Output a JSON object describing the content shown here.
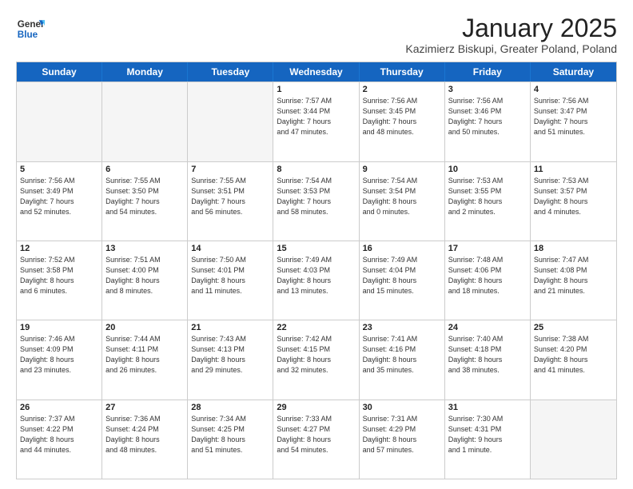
{
  "logo": {
    "general": "General",
    "blue": "Blue"
  },
  "title": "January 2025",
  "subtitle": "Kazimierz Biskupi, Greater Poland, Poland",
  "headers": [
    "Sunday",
    "Monday",
    "Tuesday",
    "Wednesday",
    "Thursday",
    "Friday",
    "Saturday"
  ],
  "rows": [
    [
      {
        "day": "",
        "info": ""
      },
      {
        "day": "",
        "info": ""
      },
      {
        "day": "",
        "info": ""
      },
      {
        "day": "1",
        "info": "Sunrise: 7:57 AM\nSunset: 3:44 PM\nDaylight: 7 hours\nand 47 minutes."
      },
      {
        "day": "2",
        "info": "Sunrise: 7:56 AM\nSunset: 3:45 PM\nDaylight: 7 hours\nand 48 minutes."
      },
      {
        "day": "3",
        "info": "Sunrise: 7:56 AM\nSunset: 3:46 PM\nDaylight: 7 hours\nand 50 minutes."
      },
      {
        "day": "4",
        "info": "Sunrise: 7:56 AM\nSunset: 3:47 PM\nDaylight: 7 hours\nand 51 minutes."
      }
    ],
    [
      {
        "day": "5",
        "info": "Sunrise: 7:56 AM\nSunset: 3:49 PM\nDaylight: 7 hours\nand 52 minutes."
      },
      {
        "day": "6",
        "info": "Sunrise: 7:55 AM\nSunset: 3:50 PM\nDaylight: 7 hours\nand 54 minutes."
      },
      {
        "day": "7",
        "info": "Sunrise: 7:55 AM\nSunset: 3:51 PM\nDaylight: 7 hours\nand 56 minutes."
      },
      {
        "day": "8",
        "info": "Sunrise: 7:54 AM\nSunset: 3:53 PM\nDaylight: 7 hours\nand 58 minutes."
      },
      {
        "day": "9",
        "info": "Sunrise: 7:54 AM\nSunset: 3:54 PM\nDaylight: 8 hours\nand 0 minutes."
      },
      {
        "day": "10",
        "info": "Sunrise: 7:53 AM\nSunset: 3:55 PM\nDaylight: 8 hours\nand 2 minutes."
      },
      {
        "day": "11",
        "info": "Sunrise: 7:53 AM\nSunset: 3:57 PM\nDaylight: 8 hours\nand 4 minutes."
      }
    ],
    [
      {
        "day": "12",
        "info": "Sunrise: 7:52 AM\nSunset: 3:58 PM\nDaylight: 8 hours\nand 6 minutes."
      },
      {
        "day": "13",
        "info": "Sunrise: 7:51 AM\nSunset: 4:00 PM\nDaylight: 8 hours\nand 8 minutes."
      },
      {
        "day": "14",
        "info": "Sunrise: 7:50 AM\nSunset: 4:01 PM\nDaylight: 8 hours\nand 11 minutes."
      },
      {
        "day": "15",
        "info": "Sunrise: 7:49 AM\nSunset: 4:03 PM\nDaylight: 8 hours\nand 13 minutes."
      },
      {
        "day": "16",
        "info": "Sunrise: 7:49 AM\nSunset: 4:04 PM\nDaylight: 8 hours\nand 15 minutes."
      },
      {
        "day": "17",
        "info": "Sunrise: 7:48 AM\nSunset: 4:06 PM\nDaylight: 8 hours\nand 18 minutes."
      },
      {
        "day": "18",
        "info": "Sunrise: 7:47 AM\nSunset: 4:08 PM\nDaylight: 8 hours\nand 21 minutes."
      }
    ],
    [
      {
        "day": "19",
        "info": "Sunrise: 7:46 AM\nSunset: 4:09 PM\nDaylight: 8 hours\nand 23 minutes."
      },
      {
        "day": "20",
        "info": "Sunrise: 7:44 AM\nSunset: 4:11 PM\nDaylight: 8 hours\nand 26 minutes."
      },
      {
        "day": "21",
        "info": "Sunrise: 7:43 AM\nSunset: 4:13 PM\nDaylight: 8 hours\nand 29 minutes."
      },
      {
        "day": "22",
        "info": "Sunrise: 7:42 AM\nSunset: 4:15 PM\nDaylight: 8 hours\nand 32 minutes."
      },
      {
        "day": "23",
        "info": "Sunrise: 7:41 AM\nSunset: 4:16 PM\nDaylight: 8 hours\nand 35 minutes."
      },
      {
        "day": "24",
        "info": "Sunrise: 7:40 AM\nSunset: 4:18 PM\nDaylight: 8 hours\nand 38 minutes."
      },
      {
        "day": "25",
        "info": "Sunrise: 7:38 AM\nSunset: 4:20 PM\nDaylight: 8 hours\nand 41 minutes."
      }
    ],
    [
      {
        "day": "26",
        "info": "Sunrise: 7:37 AM\nSunset: 4:22 PM\nDaylight: 8 hours\nand 44 minutes."
      },
      {
        "day": "27",
        "info": "Sunrise: 7:36 AM\nSunset: 4:24 PM\nDaylight: 8 hours\nand 48 minutes."
      },
      {
        "day": "28",
        "info": "Sunrise: 7:34 AM\nSunset: 4:25 PM\nDaylight: 8 hours\nand 51 minutes."
      },
      {
        "day": "29",
        "info": "Sunrise: 7:33 AM\nSunset: 4:27 PM\nDaylight: 8 hours\nand 54 minutes."
      },
      {
        "day": "30",
        "info": "Sunrise: 7:31 AM\nSunset: 4:29 PM\nDaylight: 8 hours\nand 57 minutes."
      },
      {
        "day": "31",
        "info": "Sunrise: 7:30 AM\nSunset: 4:31 PM\nDaylight: 9 hours\nand 1 minute."
      },
      {
        "day": "",
        "info": ""
      }
    ]
  ]
}
